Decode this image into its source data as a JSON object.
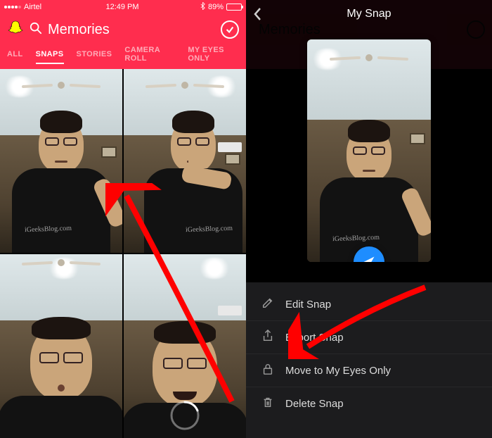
{
  "left": {
    "status": {
      "carrier": "Airtel",
      "time": "12:49 PM",
      "battery_pct": "89%"
    },
    "header": {
      "title": "Memories"
    },
    "tabs": [
      "ALL",
      "SNAPS",
      "STORIES",
      "CAMERA ROLL",
      "MY EYES ONLY"
    ],
    "active_tab_index": 1
  },
  "right": {
    "title": "My Snap",
    "menu": [
      {
        "icon": "pencil-icon",
        "label": "Edit Snap"
      },
      {
        "icon": "share-icon",
        "label": "Export Snap"
      },
      {
        "icon": "lock-icon",
        "label": "Move to My Eyes Only"
      },
      {
        "icon": "trash-icon",
        "label": "Delete Snap"
      }
    ]
  }
}
